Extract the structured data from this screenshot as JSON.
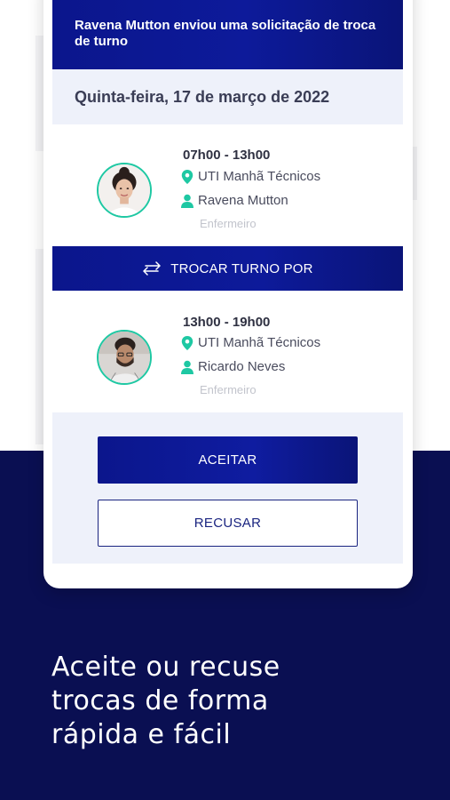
{
  "header": {
    "message": "Ravena Mutton enviou uma solicitação de troca de turno"
  },
  "date": "Quinta-feira, 17 de março de 2022",
  "shift_from": {
    "time": "07h00 - 13h00",
    "location": "UTI Manhã Técnicos",
    "person": "Ravena Mutton",
    "role": "Enfermeiro"
  },
  "swap_label": "TROCAR TURNO POR",
  "shift_to": {
    "time": "13h00 - 19h00",
    "location": "UTI Manhã Técnicos",
    "person": "Ricardo Neves",
    "role": "Enfermeiro"
  },
  "actions": {
    "accept_label": "ACEITAR",
    "refuse_label": "RECUSAR"
  },
  "tagline": {
    "line1": "Aceite ou recuse",
    "line2": "trocas de forma",
    "line3": "rápida e fácil"
  },
  "colors": {
    "primary": "#0b168c",
    "accent": "#1ec8a3",
    "background_dark": "#0a0f52",
    "surface_light": "#eef1fa"
  }
}
